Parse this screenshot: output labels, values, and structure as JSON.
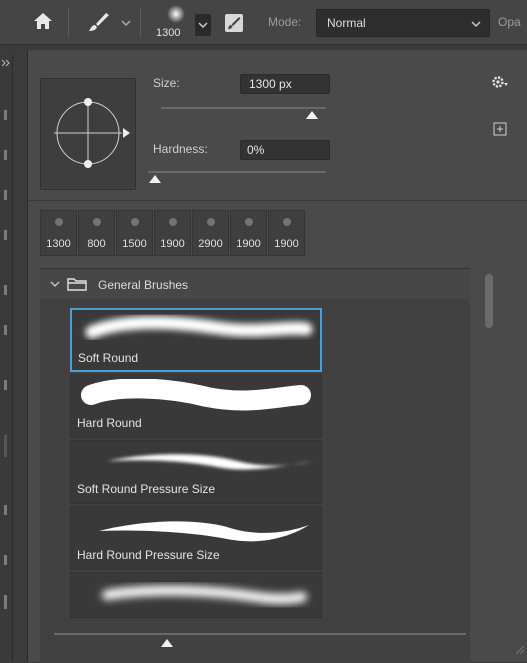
{
  "options_bar": {
    "icons": [
      "home-icon",
      "brush-tool-icon",
      "chevron-down-icon",
      "brush-panel-icon"
    ],
    "preset_size": "1300",
    "mode_label": "Mode:",
    "mode_value": "Normal",
    "opacity_label": "Opa"
  },
  "brush_picker": {
    "size_label": "Size:",
    "size_value": "1300 px",
    "size_slider_fraction": 0.95,
    "hardness_label": "Hardness:",
    "hardness_value": "0%",
    "hardness_slider_fraction": 0.0,
    "settings_icon": "gear-icon",
    "new_preset_icon": "new-preset-icon"
  },
  "recent_brushes": [
    "1300",
    "800",
    "1500",
    "1900",
    "2900",
    "1900",
    "1900"
  ],
  "brush_list": {
    "group_name": "General Brushes",
    "items": [
      {
        "name": "Soft Round",
        "selected": true
      },
      {
        "name": "Hard Round",
        "selected": false
      },
      {
        "name": "Soft Round Pressure Size",
        "selected": false
      },
      {
        "name": "Hard Round Pressure Size",
        "selected": false
      },
      {
        "name": "",
        "selected": false
      }
    ]
  },
  "colors": {
    "selection": "#4a9fd8",
    "panel": "#4a4a4a",
    "background": "#3b3b3b"
  }
}
